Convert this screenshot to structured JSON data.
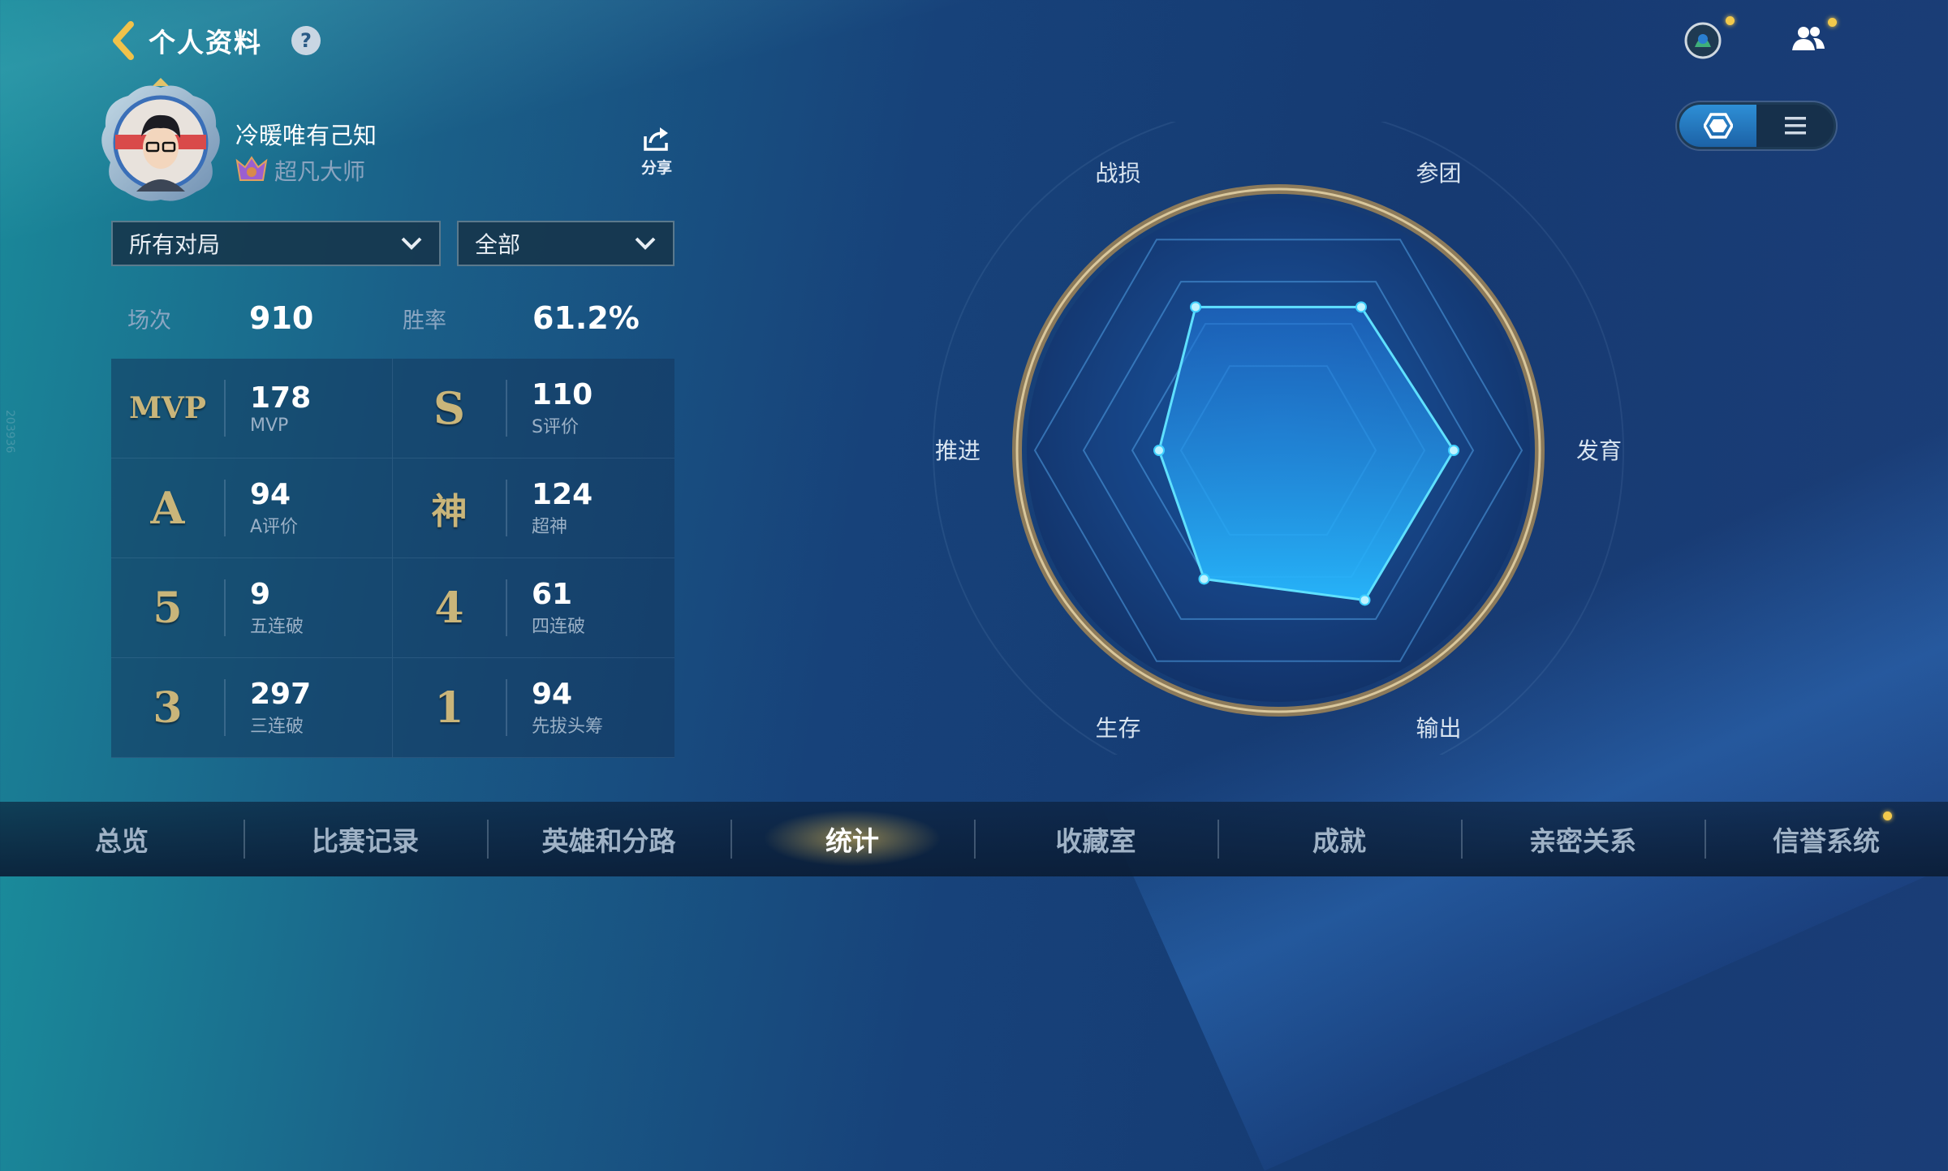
{
  "header": {
    "title": "个人资料",
    "help": "?"
  },
  "profile": {
    "name": "冷暖唯有己知",
    "rank": "超凡大师",
    "share_label": "分享"
  },
  "filters": {
    "match_type": "所有对局",
    "scope": "全部"
  },
  "summary": {
    "games_label": "场次",
    "games_value": "910",
    "winrate_label": "胜率",
    "winrate_value": "61.2%"
  },
  "stats": [
    {
      "icon": "MVP",
      "value": "178",
      "label": "MVP"
    },
    {
      "icon": "S",
      "value": "110",
      "label": "S评价"
    },
    {
      "icon": "A",
      "value": "94",
      "label": "A评价"
    },
    {
      "icon": "神",
      "value": "124",
      "label": "超神"
    },
    {
      "icon": "5",
      "value": "9",
      "label": "五连破"
    },
    {
      "icon": "4",
      "value": "61",
      "label": "四连破"
    },
    {
      "icon": "3",
      "value": "297",
      "label": "三连破"
    },
    {
      "icon": "1",
      "value": "94",
      "label": "先拔头筹"
    }
  ],
  "radar": {
    "axes": [
      "战损",
      "参团",
      "发育",
      "输出",
      "生存",
      "推进"
    ],
    "values": [
      0.68,
      0.68,
      0.72,
      0.71,
      0.61,
      0.49
    ]
  },
  "nav": {
    "items": [
      "总览",
      "比赛记录",
      "英雄和分路",
      "统计",
      "收藏室",
      "成就",
      "亲密关系",
      "信誉系统"
    ],
    "active": "统计"
  },
  "side_tag": "203936",
  "colors": {
    "accent": "#3fd0ff",
    "gold": "#c9b57a",
    "badge": "#f2c94c"
  },
  "icons": [
    "back-arrow-icon",
    "help-icon",
    "share-icon",
    "chevron-down-icon",
    "hexagon-view-icon",
    "list-view-icon",
    "hero-avatar-icon",
    "friends-icon"
  ]
}
